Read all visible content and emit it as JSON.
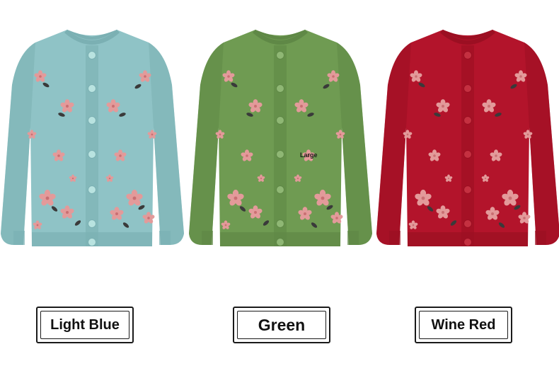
{
  "variants": [
    {
      "label": "Light Blue",
      "color": "#8fc3c6",
      "shade": "#7bb0b3",
      "button": "#b9e3e0"
    },
    {
      "label": "Green",
      "color": "#6f9b52",
      "shade": "#5f8846",
      "button": "#8fb774"
    },
    {
      "label": "Wine Red",
      "color": "#b3142b",
      "shade": "#9b0f22",
      "button": "#c43040"
    }
  ],
  "size_tag": "Large",
  "flower_color": "#e39a9a",
  "leaf_color": "#3a3a3a"
}
